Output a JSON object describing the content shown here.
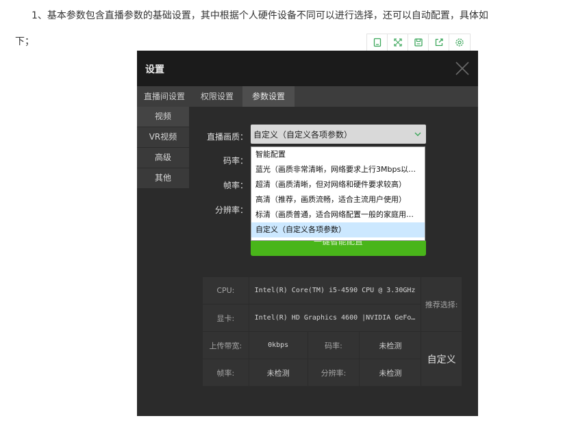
{
  "article": {
    "line1": "1、基本参数包含直播参数的基础设置，其中根据个人硬件设备不同可以进行选择，还可以自动配置，具体如",
    "line2": "下；"
  },
  "toolbar": {
    "icons": [
      "copy-icon",
      "expand-icon",
      "save-icon",
      "share-icon",
      "settings-icon"
    ],
    "accent_color": "#3aa65a"
  },
  "dialog": {
    "title": "设置",
    "tabs": [
      {
        "label": "直播间设置"
      },
      {
        "label": "权限设置"
      },
      {
        "label": "参数设置"
      }
    ],
    "sidebar": [
      {
        "label": "视频"
      },
      {
        "label": "VR视频"
      },
      {
        "label": "高级"
      },
      {
        "label": "其他"
      }
    ],
    "form": {
      "quality_label": "直播画质：",
      "bitrate_label": "码率：",
      "framerate_label": "帧率：",
      "resolution_label": "分辨率：",
      "quality_value": "自定义（自定义各项参数）",
      "options": [
        "智能配置",
        "蓝光（画质非常清晰，网络要求上行3Mbps以…",
        "超清（画质清晰，但对网络和硬件要求较高）",
        "高清（推荐，画质流畅，适合主流用户使用）",
        "标清（画质普通，适合网络配置一般的家庭用…",
        "自定义（自定义各项参数）"
      ],
      "auto_button": "一键智能配置"
    },
    "hardware": {
      "cpu_label": "CPU:",
      "cpu_value": "Intel(R) Core(TM) i5-4590 CPU @ 3.30GHz",
      "gpu_label": "显卡:",
      "gpu_value": "Intel(R) HD Graphics 4600 |NVIDIA GeFo…",
      "upload_label": "上传带宽:",
      "upload_value": "0kbps",
      "bitrate_label": "码率:",
      "bitrate_value": "未检测",
      "framerate_label": "帧率:",
      "framerate_value": "未检测",
      "resolution_label": "分辨率:",
      "resolution_value": "未检测",
      "recommend_label": "推荐选择:",
      "recommend_value": "自定义"
    },
    "colors": {
      "header_bg": "#1b1b1b",
      "body_bg": "#2b2b2b",
      "green": "#49b51a",
      "selected_option": "#cce8ff"
    }
  }
}
